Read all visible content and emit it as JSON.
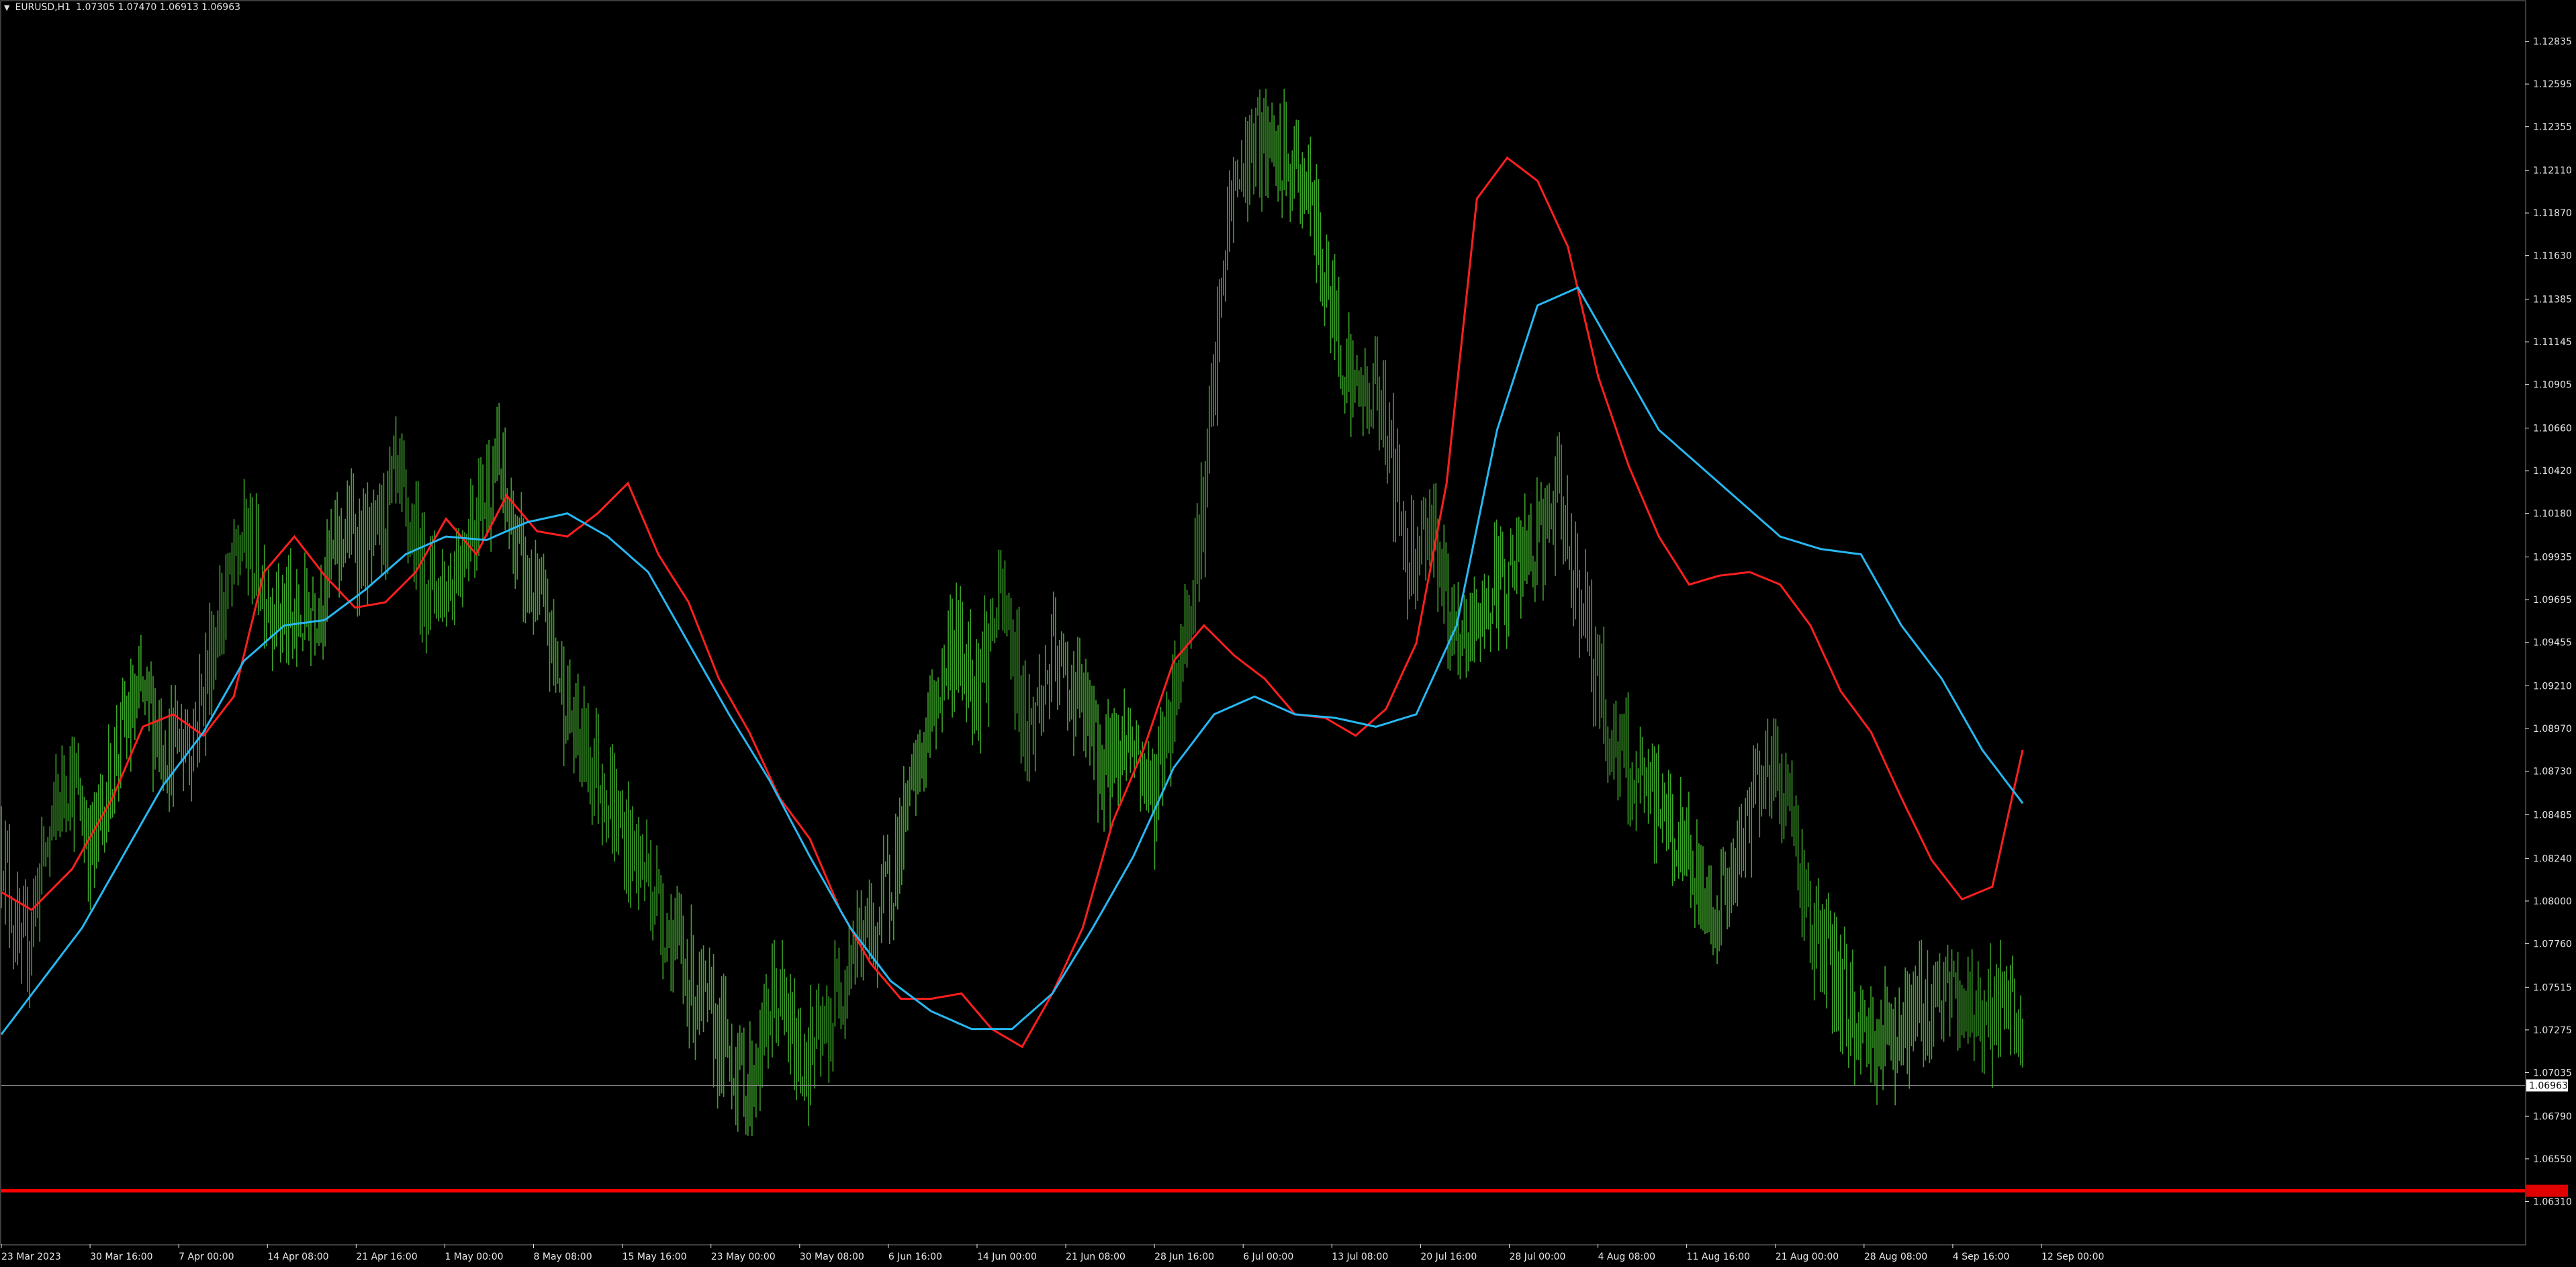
{
  "header": {
    "symbol": "EURUSD,H1",
    "ohlc": "1.07305 1.07470 1.06913 1.06963"
  },
  "colors": {
    "background": "#000000",
    "frame": "#7a7a7a",
    "axis_text": "#e8e8e8",
    "bar_color": "#3da42a",
    "ma_fast": "#ff1f1f",
    "ma_slow": "#27b8f2",
    "bid_line": "#8c8c8c",
    "level_line": "#ff0000",
    "bid_label_bg": "#ffffff",
    "bid_label_text": "#000000",
    "level_label_bg": "#e00000"
  },
  "chart_data": {
    "type": "line",
    "title": "EURUSD,H1",
    "xlabel": "",
    "ylabel": "",
    "grid": false,
    "ylim": [
      1.0607,
      1.1306
    ],
    "y_ticks": [
      "1.12835",
      "1.12595",
      "1.12355",
      "1.12110",
      "1.11870",
      "1.11630",
      "1.11385",
      "1.11145",
      "1.10905",
      "1.10660",
      "1.10420",
      "1.10180",
      "1.09935",
      "1.09695",
      "1.09455",
      "1.09210",
      "1.08970",
      "1.08730",
      "1.08485",
      "1.08240",
      "1.08000",
      "1.07760",
      "1.07515",
      "1.07275",
      "1.07035",
      "1.06790",
      "1.06550",
      "1.06310"
    ],
    "x_ticks": [
      "23 Mar 2023",
      "30 Mar 16:00",
      "7 Apr 00:00",
      "14 Apr 08:00",
      "21 Apr 16:00",
      "1 May 00:00",
      "8 May 08:00",
      "15 May 16:00",
      "23 May 00:00",
      "30 May 08:00",
      "6 Jun 16:00",
      "14 Jun 00:00",
      "21 Jun 08:00",
      "28 Jun 16:00",
      "6 Jul 00:00",
      "13 Jul 08:00",
      "20 Jul 16:00",
      "28 Jul 00:00",
      "4 Aug 08:00",
      "11 Aug 16:00",
      "21 Aug 00:00",
      "28 Aug 08:00",
      "4 Sep 16:00",
      "12 Sep 00:00"
    ],
    "bid_label": "1.06963",
    "bid_price": 1.06963,
    "horizontal_level": {
      "price": 1.0637,
      "label": ""
    },
    "price_path_x": [
      0,
      0.01,
      0.02,
      0.033,
      0.045,
      0.058,
      0.07,
      0.083,
      0.095,
      0.108,
      0.12,
      0.133,
      0.145,
      0.158,
      0.17,
      0.183,
      0.195,
      0.208,
      0.22,
      0.233,
      0.245,
      0.258,
      0.27,
      0.283,
      0.295,
      0.308,
      0.32,
      0.333,
      0.345,
      0.358,
      0.37,
      0.383,
      0.395,
      0.408,
      0.42,
      0.433,
      0.445,
      0.458,
      0.47,
      0.483,
      0.495,
      0.508,
      0.52,
      0.533,
      0.545,
      0.558,
      0.57,
      0.583,
      0.595,
      0.608,
      0.62,
      0.633,
      0.645,
      0.658,
      0.67,
      0.683,
      0.695,
      0.708,
      0.72,
      0.733,
      0.745,
      0.758,
      0.77,
      0.783,
      0.795,
      0.808,
      0.82,
      0.833,
      0.845,
      0.858,
      0.87,
      0.883,
      0.895,
      0.908,
      0.92,
      0.933,
      0.945,
      0.958,
      0.97,
      0.983,
      0.995,
      1.0
    ],
    "price_path_y": [
      1.0835,
      1.0762,
      1.082,
      1.0875,
      1.0828,
      1.089,
      1.0915,
      1.0885,
      1.0895,
      1.096,
      1.1005,
      1.097,
      1.0952,
      1.0975,
      1.101,
      1.0995,
      1.1035,
      1.0985,
      1.0975,
      1.1015,
      1.1045,
      1.0985,
      1.0955,
      1.0895,
      1.0875,
      1.0835,
      1.0815,
      1.0775,
      1.0745,
      1.0718,
      1.0695,
      1.0748,
      1.071,
      1.0722,
      1.0775,
      1.0785,
      1.0835,
      1.0895,
      1.0945,
      1.0925,
      1.097,
      1.0895,
      1.0935,
      1.0915,
      1.0875,
      1.0895,
      1.0858,
      1.0935,
      1.1025,
      1.1195,
      1.1225,
      1.1215,
      1.1205,
      1.1135,
      1.1085,
      1.1085,
      1.0995,
      1.1015,
      1.0935,
      1.0965,
      1.0985,
      1.0995,
      1.1025,
      1.0965,
      1.0895,
      1.0865,
      1.0855,
      1.0825,
      1.0795,
      1.0815,
      1.0878,
      1.0865,
      1.0785,
      1.0755,
      1.0725,
      1.0725,
      1.0735,
      1.0748,
      1.0742,
      1.0738,
      1.0735,
      1.0725
    ],
    "series": [
      {
        "name": "",
        "x": [
          0,
          0.015,
          0.035,
          0.055,
          0.07,
          0.085,
          0.1,
          0.115,
          0.13,
          0.145,
          0.16,
          0.175,
          0.19,
          0.205,
          0.22,
          0.235,
          0.25,
          0.265,
          0.28,
          0.295,
          0.31,
          0.325,
          0.34,
          0.355,
          0.37,
          0.385,
          0.4,
          0.415,
          0.43,
          0.445,
          0.46,
          0.475,
          0.49,
          0.505,
          0.52,
          0.535,
          0.55,
          0.565,
          0.58,
          0.595,
          0.61,
          0.625,
          0.64,
          0.655,
          0.67,
          0.685,
          0.7,
          0.715,
          0.73,
          0.745,
          0.76,
          0.775,
          0.79,
          0.805,
          0.82,
          0.835,
          0.85,
          0.865,
          0.88,
          0.895,
          0.91,
          0.925,
          0.94,
          0.955,
          0.97,
          0.985,
          1.0
        ],
        "y": [
          1.0805,
          1.0795,
          1.0818,
          1.0858,
          1.0898,
          1.0905,
          1.0893,
          1.0915,
          1.0985,
          1.1005,
          1.0983,
          1.0965,
          1.0968,
          1.0985,
          1.1015,
          1.0995,
          1.1028,
          1.1008,
          1.1005,
          1.1018,
          1.1035,
          1.0995,
          1.0968,
          1.0925,
          1.0895,
          1.0858,
          1.0835,
          1.0795,
          1.0765,
          1.0745,
          1.0745,
          1.0748,
          1.0728,
          1.0718,
          1.0748,
          1.0785,
          1.0845,
          1.0885,
          1.0935,
          1.0955,
          1.0938,
          1.0925,
          1.0905,
          1.0903,
          1.0893,
          1.0908,
          1.0945,
          1.1035,
          1.1195,
          1.1218,
          1.1205,
          1.1168,
          1.1095,
          1.1045,
          1.1005,
          1.0978,
          1.0983,
          1.0985,
          1.0978,
          1.0955,
          1.0918,
          1.0895,
          1.0858,
          1.0823,
          1.0801,
          1.0808,
          1.0885
        ]
      },
      {
        "name": "",
        "x": [
          0,
          0.02,
          0.04,
          0.06,
          0.08,
          0.1,
          0.12,
          0.14,
          0.16,
          0.18,
          0.2,
          0.22,
          0.24,
          0.26,
          0.28,
          0.3,
          0.32,
          0.34,
          0.36,
          0.38,
          0.4,
          0.42,
          0.44,
          0.46,
          0.48,
          0.5,
          0.52,
          0.54,
          0.56,
          0.58,
          0.6,
          0.62,
          0.64,
          0.66,
          0.68,
          0.7,
          0.72,
          0.74,
          0.76,
          0.78,
          0.8,
          0.82,
          0.84,
          0.86,
          0.88,
          0.9,
          0.92,
          0.94,
          0.96,
          0.98,
          1.0
        ],
        "y": [
          1.0725,
          1.0755,
          1.0785,
          1.0825,
          1.0865,
          1.0895,
          1.0935,
          1.0955,
          1.0958,
          1.0975,
          1.0995,
          1.1005,
          1.1003,
          1.1013,
          1.1018,
          1.1005,
          1.0985,
          1.0945,
          1.0905,
          1.0868,
          1.0825,
          1.0785,
          1.0755,
          1.0738,
          1.0728,
          1.0728,
          1.0748,
          1.0785,
          1.0825,
          1.0875,
          1.0905,
          1.0915,
          1.0905,
          1.0903,
          1.0898,
          1.0905,
          1.0955,
          1.1065,
          1.1135,
          1.1145,
          1.1105,
          1.1065,
          1.1045,
          1.1025,
          1.1005,
          1.0998,
          1.0995,
          1.0955,
          1.0925,
          1.0885,
          1.0855
        ]
      }
    ]
  }
}
